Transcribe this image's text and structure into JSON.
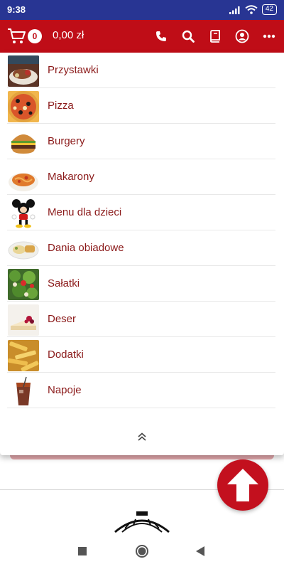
{
  "status_bar": {
    "time": "9:38",
    "battery": "42"
  },
  "app_bar": {
    "cart_count": "0",
    "cart_total": "0,00 zł",
    "actions": [
      "phone-icon",
      "search-icon",
      "book-icon",
      "account-icon",
      "more-icon"
    ]
  },
  "menu": {
    "items": [
      {
        "label": "Przystawki",
        "icon": "appetizer-thumbnail"
      },
      {
        "label": "Pizza",
        "icon": "pizza-thumbnail"
      },
      {
        "label": "Burgery",
        "icon": "burger-thumbnail"
      },
      {
        "label": "Makarony",
        "icon": "pasta-thumbnail"
      },
      {
        "label": "Menu dla dzieci",
        "icon": "mickey-mouse-thumbnail"
      },
      {
        "label": "Dania obiadowe",
        "icon": "dinner-plate-thumbnail"
      },
      {
        "label": "Sałatki",
        "icon": "salad-thumbnail"
      },
      {
        "label": "Deser",
        "icon": "dessert-thumbnail"
      },
      {
        "label": "Dodatki",
        "icon": "fries-thumbnail"
      },
      {
        "label": "Napoje",
        "icon": "drink-thumbnail"
      }
    ]
  },
  "colors": {
    "brand_red": "#bf0d17",
    "status_blue": "#283593",
    "label_red": "#8b1a1a"
  }
}
